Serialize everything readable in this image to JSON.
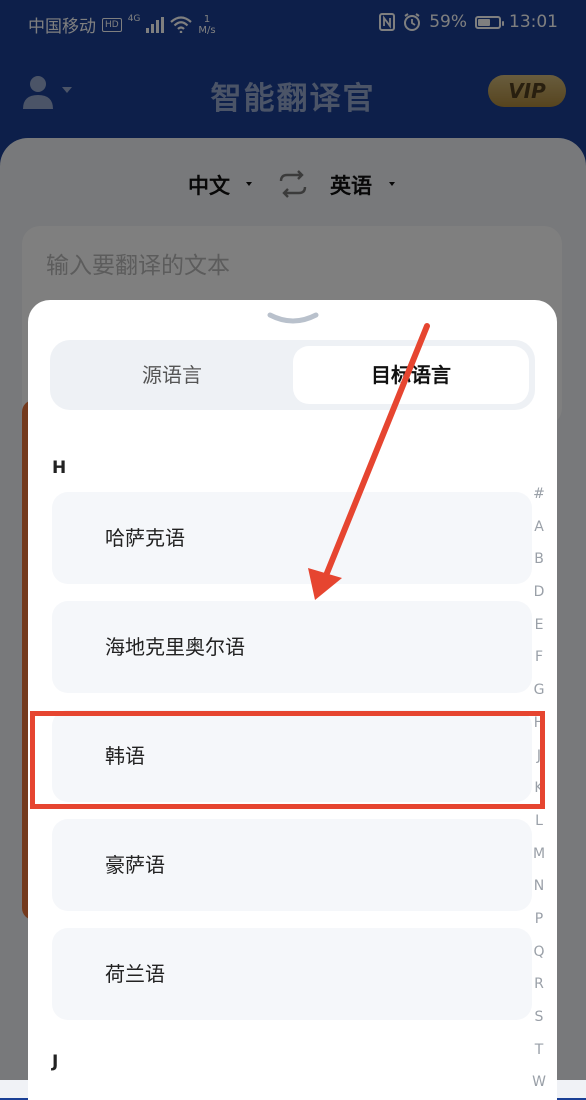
{
  "status_bar": {
    "carrier": "中国移动",
    "hd_badge": "HD",
    "network": "4G",
    "speed_value": "1",
    "speed_unit": "M/s",
    "nfc_icon": "nfc-icon",
    "alarm_icon": "alarm-icon",
    "battery_pct": "59%",
    "battery_level": 0.59,
    "time": "13:01"
  },
  "header": {
    "title": "智能翻译官",
    "vip_label": "VIP",
    "avatar_icon": "user-avatar-icon"
  },
  "lang_select": {
    "source": "中文",
    "target": "英语",
    "swap_icon": "swap-icon"
  },
  "input": {
    "placeholder": "输入要翻译的文本"
  },
  "sheet": {
    "tabs": [
      {
        "label": "源语言",
        "active": false
      },
      {
        "label": "目标语言",
        "active": true
      }
    ],
    "sections": [
      {
        "letter": "H",
        "items": [
          "哈萨克语",
          "海地克里奥尔语",
          "韩语",
          "豪萨语",
          "荷兰语"
        ]
      },
      {
        "letter": "J",
        "items": []
      }
    ],
    "index_letters": [
      "#",
      "A",
      "B",
      "D",
      "E",
      "F",
      "G",
      "H",
      "J",
      "K",
      "L",
      "M",
      "N",
      "P",
      "Q",
      "R",
      "S",
      "T",
      "W"
    ]
  },
  "colors": {
    "header_blue": "#1a3f95",
    "annotation_red": "#e64530",
    "vip_gold": "#e0b555"
  }
}
